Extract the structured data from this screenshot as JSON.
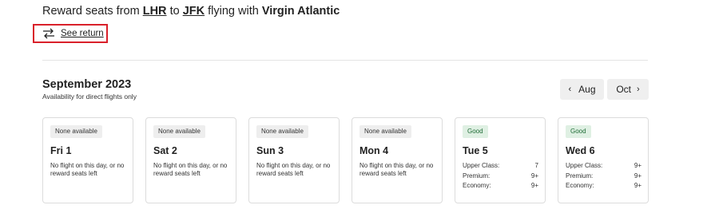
{
  "header": {
    "prefix": "Reward seats from",
    "origin": "LHR",
    "to": "to",
    "destination": "JFK",
    "flying_with": "flying with",
    "airline": "Virgin Atlantic"
  },
  "see_return": {
    "label": "See return",
    "icon": "swap-arrows-icon"
  },
  "calendar": {
    "month_title": "September 2023",
    "subtitle": "Availability for direct flights only",
    "prev_label": "Aug",
    "next_label": "Oct"
  },
  "colors": {
    "highlight_border": "#d9202a",
    "good_badge_bg": "#dff0e3",
    "good_badge_text": "#1e6b35",
    "none_badge_bg": "#eeeeee"
  },
  "days": [
    {
      "status": "None available",
      "day": "Fri 1",
      "note": "No flight on this day, or no reward seats left"
    },
    {
      "status": "None available",
      "day": "Sat 2",
      "note": "No flight on this day, or no reward seats left"
    },
    {
      "status": "None available",
      "day": "Sun 3",
      "note": "No flight on this day, or no reward seats left"
    },
    {
      "status": "None available",
      "day": "Mon 4",
      "note": "No flight on this day, or no reward seats left"
    },
    {
      "status": "Good",
      "day": "Tue 5",
      "seats": [
        {
          "cabin": "Upper Class:",
          "count": "7"
        },
        {
          "cabin": "Premium:",
          "count": "9+"
        },
        {
          "cabin": "Economy:",
          "count": "9+"
        }
      ]
    },
    {
      "status": "Good",
      "day": "Wed 6",
      "seats": [
        {
          "cabin": "Upper Class:",
          "count": "9+"
        },
        {
          "cabin": "Premium:",
          "count": "9+"
        },
        {
          "cabin": "Economy:",
          "count": "9+"
        }
      ]
    }
  ]
}
